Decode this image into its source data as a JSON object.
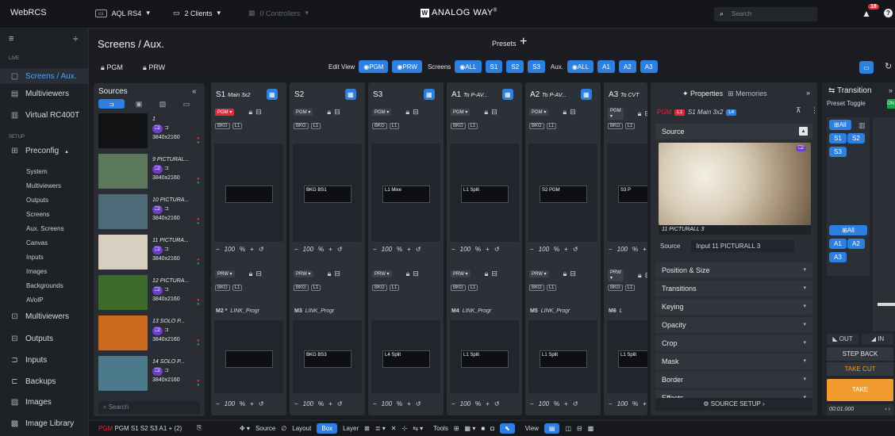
{
  "topbar": {
    "logo": "WebRCS",
    "device": "AQL RS4",
    "clients": "2 Clients",
    "controllers": "0 Controllers",
    "brand": "ANALOG WAY",
    "brand_mark": "®",
    "search_placeholder": "Search",
    "notifications": "18"
  },
  "nav": {
    "live": "LIVE",
    "setup": "SETUP",
    "items": [
      "Screens / Aux.",
      "Multiviewers",
      "Virtual RC400T",
      "Preconfig",
      "Multiviewers",
      "Outputs",
      "Inputs",
      "Backups",
      "Images",
      "Image Library"
    ],
    "sub": [
      "System",
      "Multiviewers",
      "Outputs",
      "Screens",
      "Aux. Screens",
      "Canvas",
      "Inputs",
      "Images",
      "Backgrounds",
      "AVoIP"
    ]
  },
  "header": {
    "title": "Screens / Aux.",
    "presets": "Presets",
    "pgm": "PGM",
    "prw": "PRW",
    "edit_view": "Edit View",
    "screens": "Screens",
    "aux": "Aux.",
    "all": "ALL",
    "screen_btns": [
      "S1",
      "S2",
      "S3"
    ],
    "aux_btns": [
      "A1",
      "A2",
      "A3"
    ]
  },
  "sources": {
    "title": "Sources",
    "search_placeholder": "Search",
    "items": [
      {
        "name": "1",
        "layers": "2",
        "res": "3840x2160",
        "color": "#101214"
      },
      {
        "name": "9 PICTURAL...",
        "layers": "2",
        "res": "3840x2160",
        "color": "#5b7a5c"
      },
      {
        "name": "10 PICTURA...",
        "layers": "2",
        "res": "3840x2160",
        "color": "#4c6a78"
      },
      {
        "name": "11 PICTURA...",
        "layers": "2",
        "res": "3840x2160",
        "color": "#d8cfc1"
      },
      {
        "name": "12 PICTURA...",
        "layers": "2",
        "res": "3840x2160",
        "color": "#3d6b2c"
      },
      {
        "name": "13 SOLO P...",
        "layers": "2",
        "res": "3840x2160",
        "color": "#c96a1e"
      },
      {
        "name": "14 SOLO P...",
        "layers": "2",
        "res": "3840x2160",
        "color": "#4b7a8a"
      }
    ]
  },
  "columns": [
    {
      "id": "S1",
      "sub": "Main 3x2",
      "pgm": "PGM",
      "prw": "PRW",
      "zoom": "100",
      "bottom": "M2 *",
      "link": "LINK_Progr",
      "mini_top": "",
      "mini_bot": ""
    },
    {
      "id": "S2",
      "sub": "",
      "pgm": "PGM",
      "prw": "PRW",
      "zoom": "100",
      "bottom": "M3",
      "link": "LINK_Progr",
      "mini_top": "BKG BS1",
      "mini_bot": "BKG BS3"
    },
    {
      "id": "S3",
      "sub": "",
      "pgm": "PGM",
      "prw": "PRW",
      "zoom": "100",
      "bottom": "",
      "link": "",
      "mini_top": "L1 Mixe",
      "mini_bot": "L4 Split"
    },
    {
      "id": "A1",
      "sub": "To P-AV...",
      "pgm": "PGM",
      "prw": "PRW",
      "zoom": "100",
      "bottom": "M4",
      "link": "LINK_Progr",
      "mini_top": "L1 Split",
      "mini_bot": "L1 Split"
    },
    {
      "id": "A2",
      "sub": "To P-AV...",
      "pgm": "PGM",
      "prw": "PRW",
      "zoom": "100",
      "bottom": "M5",
      "link": "LINK_Progr",
      "mini_top": "S2 PGM",
      "mini_bot": "L1 Split"
    },
    {
      "id": "A3",
      "sub": "To CVT",
      "pgm": "PGM",
      "prw": "PRW",
      "zoom": "100",
      "bottom": "M6",
      "link": "L",
      "mini_top": "S3 P",
      "mini_bot": "L1 Split"
    }
  ],
  "tags": {
    "bkg": "BKG",
    "l1": "L1",
    "split": "Split",
    "pct": "%"
  },
  "properties": {
    "tab_props": "Properties",
    "tab_mem": "Memories",
    "pgm_line": "PGM",
    "screen_line": "S1 Main 3x2",
    "layer": "L4",
    "section": "Source",
    "thumb_label": "11 PICTURALL 3",
    "source_label": "Source",
    "source_value": "Input 11 PICTURALL 3",
    "rows": [
      "Position & Size",
      "Transitions",
      "Keying",
      "Opacity",
      "Crop",
      "Mask",
      "Border",
      "Effects"
    ],
    "setup": "SOURCE SETUP"
  },
  "transition": {
    "title": "Transition",
    "preset_toggle": "Preset Toggle",
    "on": "ON",
    "all": "All",
    "s_btns": [
      "S1",
      "S2",
      "S3"
    ],
    "a_btns": [
      "A1",
      "A2",
      "A3"
    ],
    "out": "OUT",
    "in": "IN",
    "step_back": "STEP BACK",
    "take_cut": "TAKE CUT",
    "take": "TAKE",
    "time": "00:01.000"
  },
  "bottombar": {
    "pgm": "PGM S1 S2 S3 A1 + (2)",
    "source": "Source",
    "layout": "Layout",
    "box": "Box",
    "layer": "Layer",
    "tools": "Tools",
    "view": "View"
  },
  "colors": {
    "accent": "#2d7fe0",
    "red": "#e02a3a",
    "take": "#f29a2e",
    "purple": "#6b3fc6"
  }
}
